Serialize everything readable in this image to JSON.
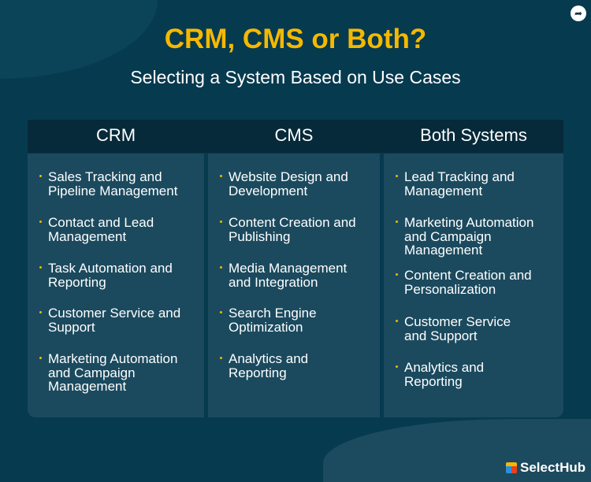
{
  "title": "CRM, CMS or Both?",
  "subtitle": "Selecting a System Based on Use Cases",
  "columns": [
    {
      "header": "CRM",
      "items": [
        "Sales Tracking and\nPipeline Management",
        "Contact and Lead\nManagement",
        "Task Automation and\nReporting",
        "Customer Service and\nSupport",
        "Marketing Automation\nand Campaign\nManagement"
      ]
    },
    {
      "header": "CMS",
      "items": [
        "Website Design and\nDevelopment",
        "Content Creation and\nPublishing",
        "Media Management\nand Integration",
        "Search Engine\nOptimization",
        "Analytics and\nReporting"
      ]
    },
    {
      "header": "Both Systems",
      "items": [
        "Lead Tracking and\nManagement",
        "Marketing Automation\nand Campaign\nManagement",
        "Content Creation and\nPersonalization",
        "Customer Service\nand Support",
        "Analytics and\nReporting"
      ]
    }
  ],
  "brand": {
    "name": "SelectHub",
    "accent": "#f5b800"
  },
  "icons": {
    "share": "share-icon",
    "logo": "selecthub-cube-icon"
  }
}
